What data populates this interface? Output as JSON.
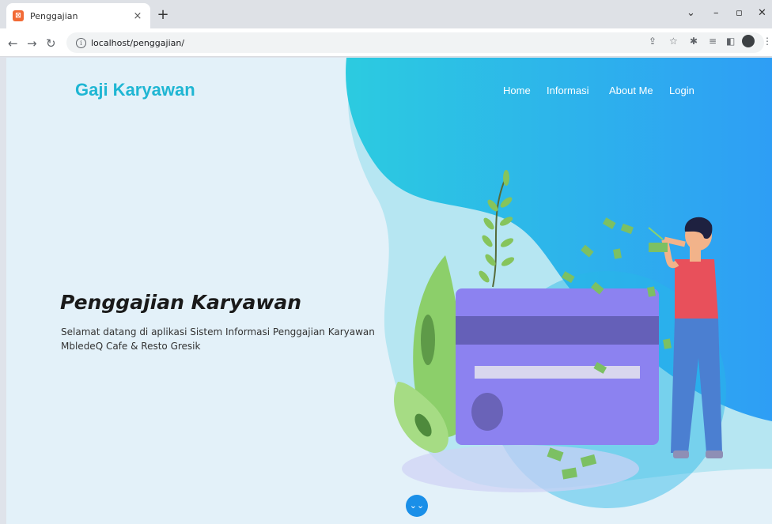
{
  "browser": {
    "tab_title": "Penggajian",
    "tab_close": "×",
    "new_tab": "+",
    "url": "localhost/penggajian/",
    "favicon_letter": "⊠"
  },
  "site": {
    "brand": "Gaji Karyawan",
    "nav": [
      "Home",
      "Informasi",
      "About Me",
      "Login"
    ]
  },
  "hero": {
    "title": "Penggajian Karyawan",
    "subtitle": "Selamat datang di aplikasi Sistem Informasi Penggajian Karyawan MbledeQ Cafe & Resto Gresik"
  },
  "colors": {
    "brand": "#1fb6d3",
    "card": "#8c82f0",
    "stripe": "#6560b8",
    "person_shirt": "#e8505b",
    "accent_blue": "#1a8fe8"
  },
  "icons": {
    "scroll": "chevron-double-down-icon"
  }
}
